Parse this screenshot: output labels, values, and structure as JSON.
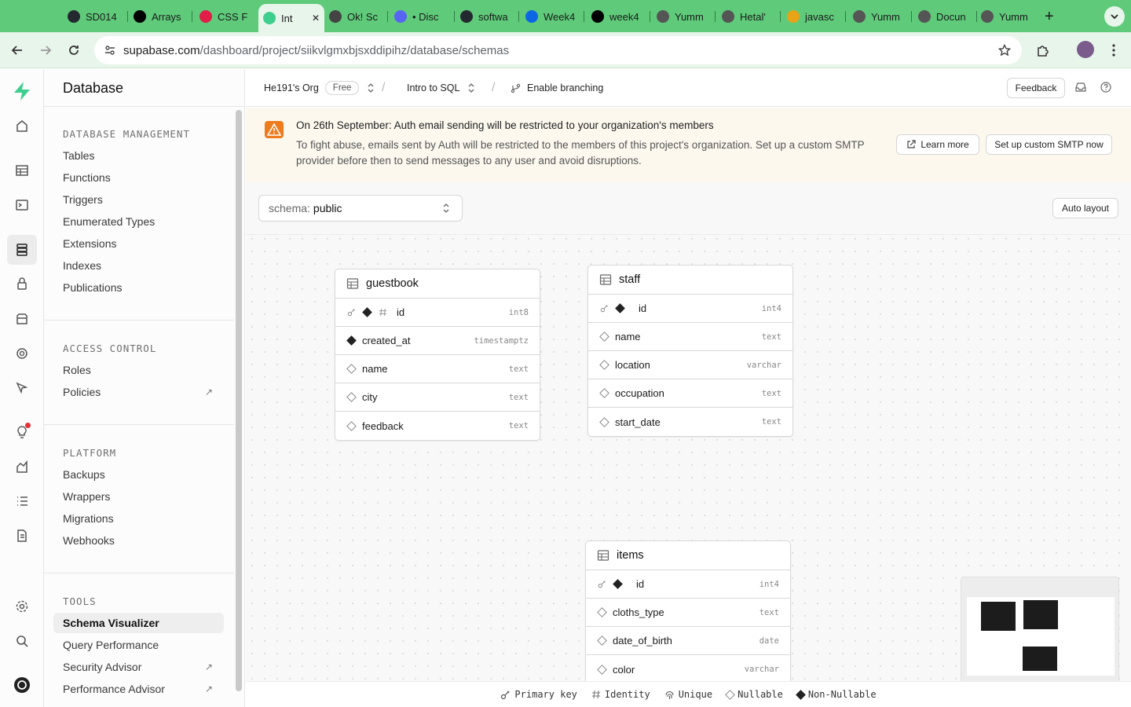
{
  "browser": {
    "tabs": [
      {
        "label": "SD014",
        "icon": "github-icon",
        "color": "#24292f"
      },
      {
        "label": "Arrays",
        "icon": "medium-icon",
        "color": "#000000"
      },
      {
        "label": "CSS F",
        "icon": "star-icon",
        "color": "#e11d48"
      },
      {
        "label": "Int",
        "icon": "supabase-icon",
        "color": "#3ecf8e",
        "active": true
      },
      {
        "label": "Ok! Sc",
        "icon": "figure-icon",
        "color": "#444444"
      },
      {
        "label": "• Disc",
        "icon": "discord-icon",
        "color": "#5865f2"
      },
      {
        "label": "softwa",
        "icon": "github-icon",
        "color": "#24292f"
      },
      {
        "label": "Week4",
        "icon": "trello-icon",
        "color": "#0c66e4"
      },
      {
        "label": "week4",
        "icon": "notion-icon",
        "color": "#000000"
      },
      {
        "label": "Yumm",
        "icon": "globe-icon",
        "color": "#555555"
      },
      {
        "label": "Hetal'",
        "icon": "globe-icon",
        "color": "#555555"
      },
      {
        "label": "javasc",
        "icon": "js-icon",
        "color": "#e8a317"
      },
      {
        "label": "Yumm",
        "icon": "globe-icon",
        "color": "#555555"
      },
      {
        "label": "Docun",
        "icon": "globe-icon",
        "color": "#555555"
      },
      {
        "label": "Yumm",
        "icon": "globe-icon",
        "color": "#555555"
      }
    ],
    "new_tab": "+",
    "url_domain": "supabase.com",
    "url_path": "/dashboard/project/siikvlgmxbjsxddipihz/database/schemas"
  },
  "topbar": {
    "org": "He191's Org",
    "plan": "Free",
    "project": "Intro to SQL",
    "branching": "Enable branching",
    "feedback": "Feedback"
  },
  "banner": {
    "title": "On 26th September: Auth email sending will be restricted to your organization's members",
    "body": "To fight abuse, emails sent by Auth will be restricted to the members of this project's organization. Set up a custom SMTP provider before then to send messages to any user and avoid disruptions.",
    "learn_more": "Learn more",
    "setup_smtp": "Set up custom SMTP now"
  },
  "sidebar": {
    "title": "Database",
    "sections": [
      {
        "title": "DATABASE MANAGEMENT",
        "items": [
          "Tables",
          "Functions",
          "Triggers",
          "Enumerated Types",
          "Extensions",
          "Indexes",
          "Publications"
        ]
      },
      {
        "title": "ACCESS CONTROL",
        "items": [
          "Roles",
          "Policies"
        ]
      },
      {
        "title": "PLATFORM",
        "items": [
          "Backups",
          "Wrappers",
          "Migrations",
          "Webhooks"
        ]
      },
      {
        "title": "TOOLS",
        "items": [
          "Schema Visualizer",
          "Query Performance",
          "Security Advisor",
          "Performance Advisor"
        ]
      }
    ],
    "active_item": "Schema Visualizer",
    "external_items": [
      "Policies",
      "Security Advisor",
      "Performance Advisor"
    ]
  },
  "canvas": {
    "schema_label": "schema:",
    "schema_value": "public",
    "auto_layout": "Auto layout",
    "tables": [
      {
        "name": "guestbook",
        "columns": [
          {
            "name": "id",
            "type": "int8",
            "pk": true,
            "nullable": false,
            "identity": true
          },
          {
            "name": "created_at",
            "type": "timestamptz",
            "pk": false,
            "nullable": false,
            "identity": false
          },
          {
            "name": "name",
            "type": "text",
            "pk": false,
            "nullable": true,
            "identity": false
          },
          {
            "name": "city",
            "type": "text",
            "pk": false,
            "nullable": true,
            "identity": false
          },
          {
            "name": "feedback",
            "type": "text",
            "pk": false,
            "nullable": true,
            "identity": false
          }
        ]
      },
      {
        "name": "staff",
        "columns": [
          {
            "name": "id",
            "type": "int4",
            "pk": true,
            "nullable": false,
            "identity": false
          },
          {
            "name": "name",
            "type": "text",
            "pk": false,
            "nullable": true,
            "identity": false
          },
          {
            "name": "location",
            "type": "varchar",
            "pk": false,
            "nullable": true,
            "identity": false
          },
          {
            "name": "occupation",
            "type": "text",
            "pk": false,
            "nullable": true,
            "identity": false
          },
          {
            "name": "start_date",
            "type": "text",
            "pk": false,
            "nullable": true,
            "identity": false
          }
        ]
      },
      {
        "name": "items",
        "columns": [
          {
            "name": "id",
            "type": "int4",
            "pk": true,
            "nullable": false,
            "identity": false
          },
          {
            "name": "cloths_type",
            "type": "text",
            "pk": false,
            "nullable": true,
            "identity": false
          },
          {
            "name": "date_of_birth",
            "type": "date",
            "pk": false,
            "nullable": true,
            "identity": false
          },
          {
            "name": "color",
            "type": "varchar",
            "pk": false,
            "nullable": true,
            "identity": false
          }
        ]
      }
    ]
  },
  "legend": {
    "primary_key": "Primary key",
    "identity": "Identity",
    "unique": "Unique",
    "nullable": "Nullable",
    "non_nullable": "Non-Nullable"
  },
  "colors": {
    "brand": "#3ecf8e",
    "tabbar": "#5fcb7a",
    "warning": "#ee7b1c"
  }
}
